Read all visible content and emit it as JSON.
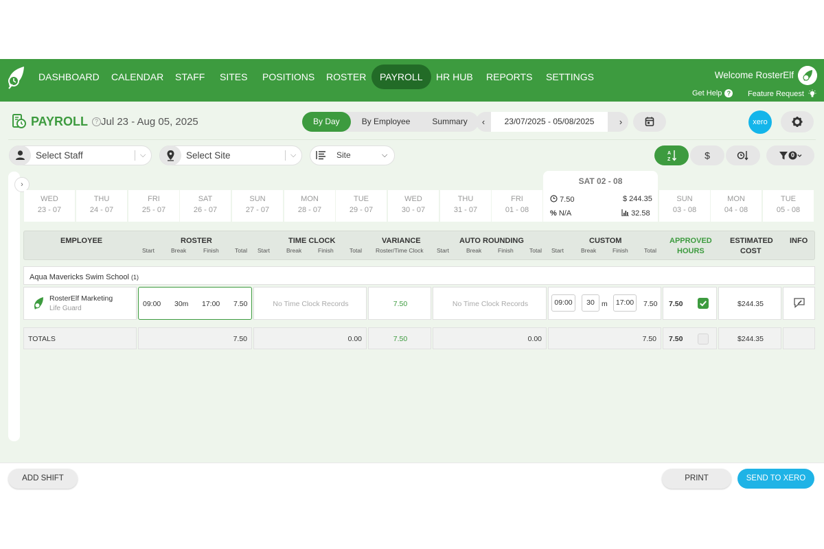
{
  "nav": {
    "items": [
      {
        "label": "DASHBOARD"
      },
      {
        "label": "CALENDAR"
      },
      {
        "label": "STAFF"
      },
      {
        "label": "SITES"
      },
      {
        "label": "POSITIONS"
      },
      {
        "label": "ROSTER"
      },
      {
        "label": "PAYROLL",
        "active": true
      },
      {
        "label": "HR HUB"
      },
      {
        "label": "REPORTS"
      },
      {
        "label": "SETTINGS"
      }
    ],
    "welcome": "Welcome RosterElf",
    "get_help": "Get Help",
    "feature_request": "Feature Request"
  },
  "header": {
    "title": "PAYROLL",
    "period": "Jul 23 - Aug 05, 2025",
    "view_tabs": [
      "By Day",
      "By Employee",
      "Summary"
    ],
    "active_view": "By Day",
    "date_range": "23/07/2025 - 05/08/2025",
    "xero_label": "xero"
  },
  "filters": {
    "staff_placeholder": "Select Staff",
    "site_placeholder": "Select Site",
    "group_by": "Site",
    "filter_count": "0"
  },
  "days": [
    {
      "name": "WED",
      "date": "23 - 07"
    },
    {
      "name": "THU",
      "date": "24 - 07"
    },
    {
      "name": "FRI",
      "date": "25 - 07"
    },
    {
      "name": "SAT",
      "date": "26 - 07"
    },
    {
      "name": "SUN",
      "date": "27 - 07"
    },
    {
      "name": "MON",
      "date": "28 - 07"
    },
    {
      "name": "TUE",
      "date": "29 - 07"
    },
    {
      "name": "WED",
      "date": "30 - 07"
    },
    {
      "name": "THU",
      "date": "31 - 07"
    },
    {
      "name": "FRI",
      "date": "01 - 08"
    },
    {
      "name": "SUN",
      "date": "03 - 08"
    },
    {
      "name": "MON",
      "date": "04 - 08"
    },
    {
      "name": "TUE",
      "date": "05 - 08"
    }
  ],
  "selected_day": {
    "title": "SAT 02 - 08",
    "hours": "7.50",
    "cost": "$ 244.35",
    "percent": "N/A",
    "chart_value": "32.58"
  },
  "columns": {
    "employee": "EMPLOYEE",
    "roster": "ROSTER",
    "time_clock": "TIME CLOCK",
    "variance": "VARIANCE",
    "auto_rounding": "AUTO ROUNDING",
    "custom": "CUSTOM",
    "approved_1": "APPROVED",
    "approved_2": "HOURS",
    "estimated_1": "ESTIMATED",
    "estimated_2": "COST",
    "info": "INFO",
    "sub_start": "Start",
    "sub_break": "Break",
    "sub_finish": "Finish",
    "sub_total": "Total",
    "sub_variance": "Roster/Time Clock"
  },
  "group": {
    "name": "Aqua Mavericks Swim School",
    "count": "(1)"
  },
  "row": {
    "employee_name": "RosterElf Marketing",
    "employee_role": "Life Guard",
    "roster_start": "09:00",
    "roster_break": "30m",
    "roster_finish": "17:00",
    "roster_total": "7.50",
    "time_clock": "No Time Clock Records",
    "variance": "7.50",
    "auto_rounding": "No Time Clock Records",
    "custom_start": "09:00",
    "custom_break": "30",
    "custom_break_unit": "m",
    "custom_finish": "17:00",
    "custom_total": "7.50",
    "approved": "7.50",
    "approved_checked": true,
    "cost": "$244.35"
  },
  "totals": {
    "label": "TOTALS",
    "roster": "7.50",
    "time_clock": "0.00",
    "variance": "7.50",
    "auto_rounding": "0.00",
    "custom": "7.50",
    "approved": "7.50",
    "cost": "$244.35"
  },
  "footer": {
    "add_shift": "ADD SHIFT",
    "print": "PRINT",
    "send_to_xero": "SEND TO XERO"
  },
  "colors": {
    "brand_green": "#3d9b3f",
    "nav_active": "#226b27",
    "xero_blue": "#13b5ea"
  }
}
